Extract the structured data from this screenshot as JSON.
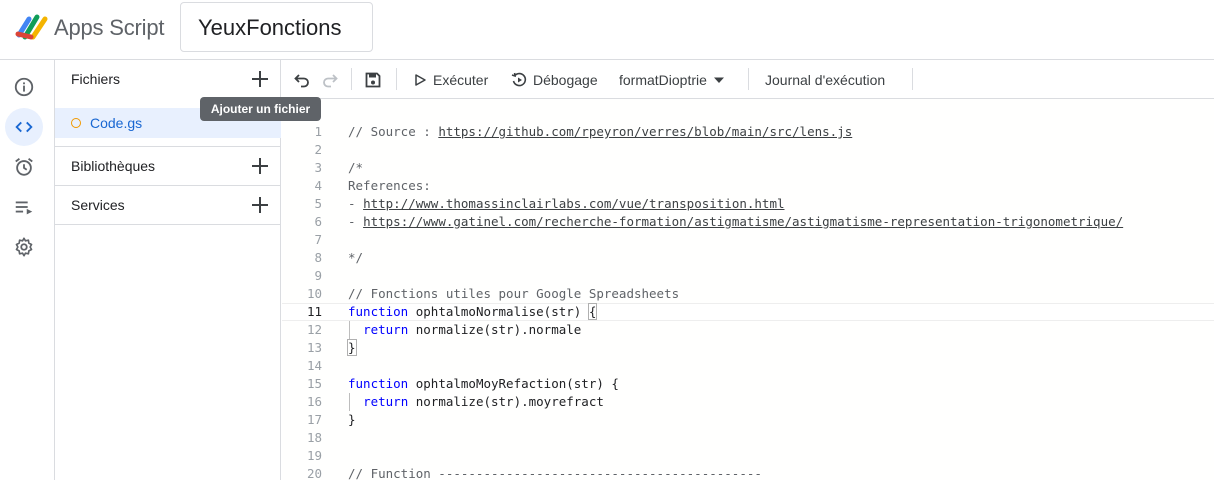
{
  "header": {
    "app_name": "Apps Script",
    "project_title": "YeuxFonctions"
  },
  "rail": {
    "items": [
      {
        "icon": "info-icon"
      },
      {
        "icon": "code-icon",
        "active": true
      },
      {
        "icon": "alarm-icon"
      },
      {
        "icon": "executions-icon"
      },
      {
        "icon": "gear-icon"
      }
    ]
  },
  "files_panel": {
    "files_label": "Fichiers",
    "file_name": "Code.gs",
    "libraries_label": "Bibliothèques",
    "services_label": "Services",
    "tooltip": "Ajouter un fichier"
  },
  "toolbar": {
    "run_label": "Exécuter",
    "debug_label": "Débogage",
    "function_select": "formatDioptrie",
    "log_label": "Journal d'exécution"
  },
  "colors": {
    "accent": "#1967d2",
    "active_bg": "#e8f0fe",
    "keyword": "#0000ff",
    "file_dot": "#f29900"
  },
  "editor": {
    "current_line": 11,
    "lines": [
      {
        "n": "1",
        "t": "// Source : https://github.com/rpeyron/verres/blob/main/src/lens.js"
      },
      {
        "n": "2",
        "t": ""
      },
      {
        "n": "3",
        "t": "/*"
      },
      {
        "n": "4",
        "t": "References:"
      },
      {
        "n": "5",
        "t": "- http://www.thomassinclairlabs.com/vue/transposition.html"
      },
      {
        "n": "6",
        "t": "- https://www.gatinel.com/recherche-formation/astigmatisme/astigmatisme-representation-trigonometrique/"
      },
      {
        "n": "7",
        "t": ""
      },
      {
        "n": "8",
        "t": "*/"
      },
      {
        "n": "9",
        "t": ""
      },
      {
        "n": "10",
        "t": "// Fonctions utiles pour Google Spreadsheets"
      },
      {
        "n": "11",
        "t": "function ophtalmoNormalise(str) {"
      },
      {
        "n": "12",
        "t": "  return normalize(str).normale"
      },
      {
        "n": "13",
        "t": "}"
      },
      {
        "n": "14",
        "t": ""
      },
      {
        "n": "15",
        "t": "function ophtalmoMoyRefaction(str) {"
      },
      {
        "n": "16",
        "t": "  return normalize(str).moyrefract"
      },
      {
        "n": "17",
        "t": "}"
      },
      {
        "n": "18",
        "t": ""
      },
      {
        "n": "19",
        "t": ""
      },
      {
        "n": "20",
        "t": "// Function -------------------------------------------"
      }
    ]
  }
}
